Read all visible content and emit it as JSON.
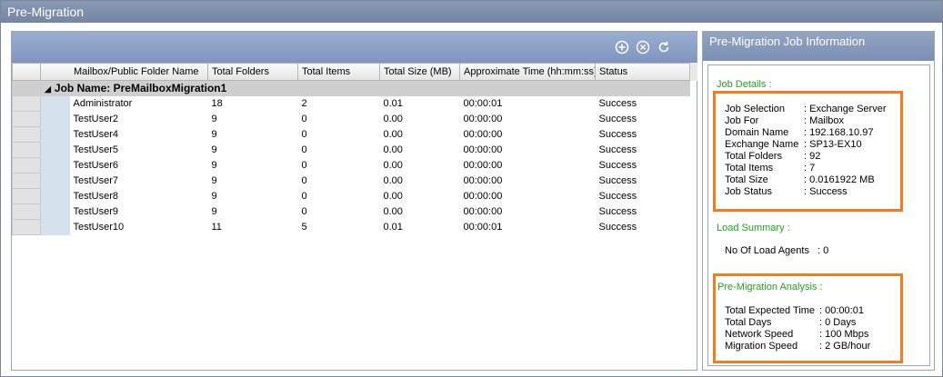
{
  "window": {
    "title": "Pre-Migration"
  },
  "toolbar": {
    "icons": [
      "add-circle-icon",
      "cancel-circle-icon",
      "refresh-icon"
    ]
  },
  "grid": {
    "columns": [
      "Mailbox/Public Folder Name",
      "Total Folders",
      "Total Items",
      "Total Size (MB)",
      "Approximate Time (hh:mm:ss)",
      "Status"
    ],
    "group_label": "Job Name: PreMailboxMigration1",
    "rows": [
      [
        "Administrator",
        "18",
        "2",
        "0.01",
        "00:00:01",
        "Success"
      ],
      [
        "TestUser2",
        "9",
        "0",
        "0.00",
        "00:00:00",
        "Success"
      ],
      [
        "TestUser4",
        "9",
        "0",
        "0.00",
        "00:00:00",
        "Success"
      ],
      [
        "TestUser5",
        "9",
        "0",
        "0.00",
        "00:00:00",
        "Success"
      ],
      [
        "TestUser6",
        "9",
        "0",
        "0.00",
        "00:00:00",
        "Success"
      ],
      [
        "TestUser7",
        "9",
        "0",
        "0.00",
        "00:00:00",
        "Success"
      ],
      [
        "TestUser8",
        "9",
        "0",
        "0.00",
        "00:00:00",
        "Success"
      ],
      [
        "TestUser9",
        "9",
        "0",
        "0.00",
        "00:00:00",
        "Success"
      ],
      [
        "TestUser10",
        "11",
        "5",
        "0.01",
        "00:00:01",
        "Success"
      ]
    ]
  },
  "info": {
    "title": "Pre-Migration Job Information",
    "job_details_title": "Job Details :",
    "job_details": [
      {
        "k": "Job Selection",
        "v": ": Exchange Server"
      },
      {
        "k": "Job For",
        "v": ": Mailbox"
      },
      {
        "k": "Domain Name",
        "v": ": 192.168.10.97"
      },
      {
        "k": "Exchange Name",
        "v": ": SP13-EX10"
      },
      {
        "k": "Total Folders",
        "v": ": 92"
      },
      {
        "k": "Total Items",
        "v": ": 7"
      },
      {
        "k": "Total Size",
        "v": ": 0.0161922 MB"
      },
      {
        "k": "Job  Status",
        "v": ": Success"
      }
    ],
    "load_summary_title": "Load Summary :",
    "load_agents_label": "No Of Load Agents",
    "load_agents_value": ":   0",
    "analysis_title": "Pre-Migration Analysis :",
    "analysis": [
      {
        "k": "Total Expected Time",
        "v": ": 00:00:01"
      },
      {
        "k": "Total Days",
        "v": ": 0 Days"
      },
      {
        "k": "Network Speed",
        "v": ": 100 Mbps"
      },
      {
        "k": "Migration Speed",
        "v": ": 2 GB/hour"
      }
    ]
  }
}
